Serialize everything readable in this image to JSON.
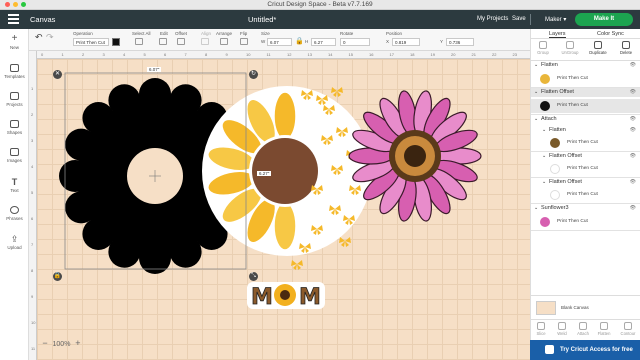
{
  "window": {
    "title": "Cricut Design Space - Beta v7.7.169"
  },
  "header": {
    "canvas_label": "Canvas",
    "doc_title": "Untitled*",
    "my_projects": "My Projects",
    "save": "Save",
    "machine": "Maker",
    "make_it": "Make It"
  },
  "toolbar": {
    "operation_label": "Operation",
    "operation_value": "Print Then Cut",
    "select_all": "Select All",
    "edit": "Edit",
    "offset": "Offset",
    "align": "Align",
    "arrange": "Arrange",
    "flip": "Flip",
    "size": "Size",
    "w_label": "W",
    "w_value": "6.07",
    "h_label": "H",
    "h_value": "6.27",
    "rotate": "Rotate",
    "rotate_value": "0",
    "position": "Position",
    "x_label": "X",
    "x_value": "0.819",
    "y_label": "Y",
    "y_value": "0.736"
  },
  "leftnav": [
    {
      "label": "New"
    },
    {
      "label": "Templates"
    },
    {
      "label": "Projects"
    },
    {
      "label": "Shapes"
    },
    {
      "label": "Images"
    },
    {
      "label": "Text"
    },
    {
      "label": "Phrases"
    },
    {
      "label": "Upload"
    }
  ],
  "ruler": {
    "top": [
      "0",
      "1",
      "2",
      "3",
      "4",
      "5",
      "6",
      "7",
      "8",
      "9",
      "10",
      "11",
      "12",
      "13",
      "14",
      "15",
      "16",
      "17",
      "18",
      "19",
      "20",
      "21",
      "22",
      "23"
    ],
    "left": [
      "1",
      "2",
      "3",
      "4",
      "5",
      "6",
      "7",
      "8",
      "9",
      "10",
      "11"
    ]
  },
  "canvas": {
    "width_label": "6.07\"",
    "height_label": "6.27\"",
    "zoom": "100%"
  },
  "panel": {
    "tabs": [
      "Layers",
      "Color Sync"
    ],
    "actions": [
      "Group",
      "UnGroup",
      "Duplicate",
      "Delete"
    ],
    "layers": [
      {
        "type": "group",
        "label": "Flatten",
        "expanded": true
      },
      {
        "type": "item",
        "label": "Print Then Cut",
        "thumb": "#e9b63a"
      },
      {
        "type": "group",
        "label": "Flatten Offset",
        "expanded": true,
        "selected": true
      },
      {
        "type": "item",
        "label": "Print Then Cut",
        "thumb": "#111111",
        "selected": true
      },
      {
        "type": "group",
        "label": "Attach",
        "expanded": true
      },
      {
        "type": "subgroup",
        "label": "Flatten"
      },
      {
        "type": "item",
        "label": "Print Then Cut",
        "thumb": "#7a5a2a"
      },
      {
        "type": "subgroup",
        "label": "Flatten Offset"
      },
      {
        "type": "item",
        "label": "Print Then Cut",
        "thumb": "#ffffff"
      },
      {
        "type": "subgroup",
        "label": "Flatten Offset"
      },
      {
        "type": "item",
        "label": "Print Then Cut",
        "thumb": "#ffffff"
      },
      {
        "type": "group",
        "label": "Sunflower3"
      },
      {
        "type": "item",
        "label": "Print Then Cut",
        "thumb": "#d75fb0"
      }
    ],
    "blank_canvas": "Blank Canvas",
    "bottom_actions": [
      "Slice",
      "Weld",
      "Attach",
      "Flatten",
      "Contour"
    ]
  },
  "cta": {
    "label": "Try Cricut Access for free"
  },
  "colors": {
    "header": "#2c3a3f",
    "accent_green": "#1ca450",
    "canvas_bg": "#f6dfc6",
    "cta_blue": "#1a5fa8"
  }
}
